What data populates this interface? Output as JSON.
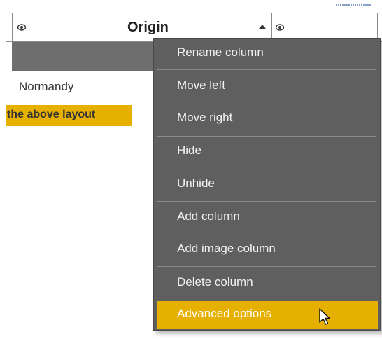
{
  "table": {
    "header_column_title": "Origin",
    "visible_cell_value": "Normandy",
    "header_icons": [
      "eye-icon",
      "eye-icon"
    ],
    "sort_indicator": "sort-ascending-icon"
  },
  "caption": {
    "text": "the above layout",
    "color": "#e6b000"
  },
  "context_menu": {
    "items": [
      {
        "label": "Rename column",
        "group": 1
      },
      {
        "label": "Move left",
        "group": 2
      },
      {
        "label": "Move right",
        "group": 2
      },
      {
        "label": "Hide",
        "group": 3
      },
      {
        "label": "Unhide",
        "group": 3
      },
      {
        "label": "Add column",
        "group": 4
      },
      {
        "label": "Add image column",
        "group": 4
      },
      {
        "label": "Delete column",
        "group": 5
      },
      {
        "label": "Advanced options",
        "group": 5,
        "selected": true
      }
    ],
    "background_color": "#5f5f5f",
    "highlight_color": "#e6b000"
  },
  "cursor": "mouse-pointer-icon"
}
